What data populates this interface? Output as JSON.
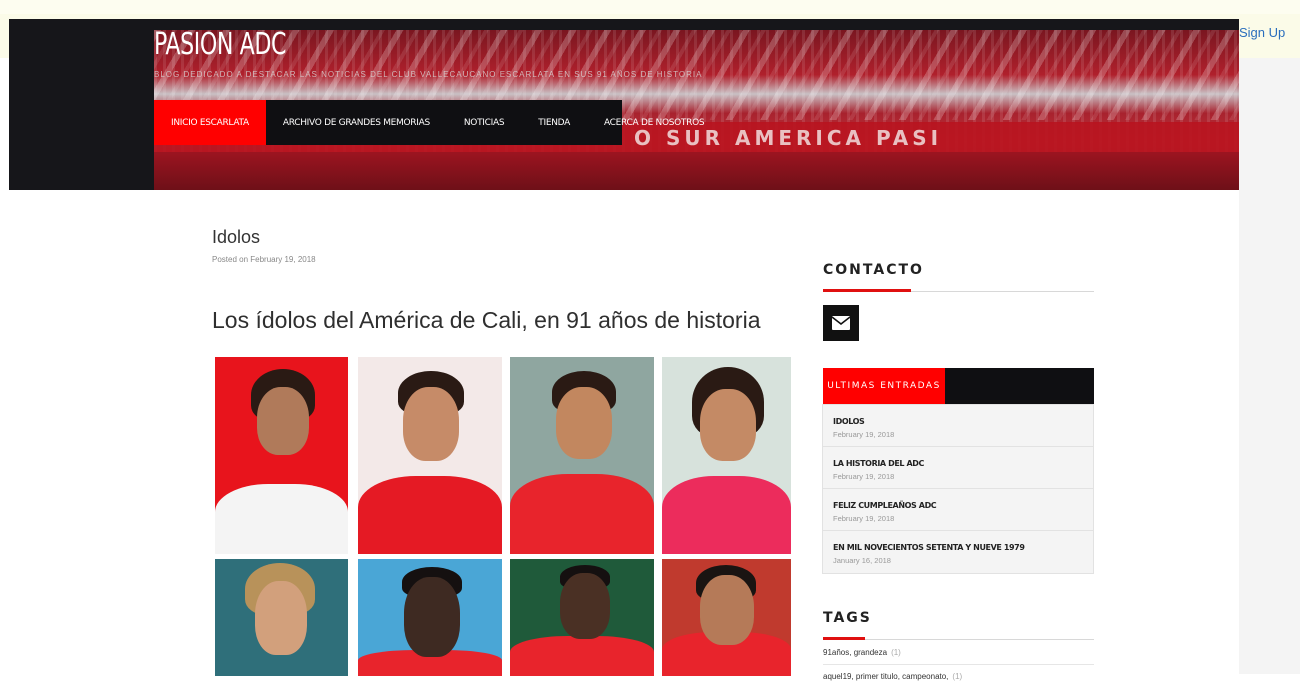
{
  "header": {
    "sign_up": "Sign Up",
    "site_title": "PASION ADC",
    "tagline": "BLOG DEDICADO A DESTACAR LAS NOTICIAS DEL CLUB VALLECAUCANO ESCARLATA EN SUS 91 AÑOS DE HISTORIA",
    "banner_slogan": "O SUR AMERICA PASI",
    "nav": [
      {
        "label": "INICIO ESCARLATA",
        "active": true
      },
      {
        "label": "ARCHIVO DE GRANDES MEMORIAS",
        "active": false
      },
      {
        "label": "NOTICIAS",
        "active": false
      },
      {
        "label": "TIENDA",
        "active": false
      },
      {
        "label": "ACERCA DE NOSOTROS",
        "active": false
      }
    ]
  },
  "post": {
    "title": "Idolos",
    "meta": "Posted on February 19, 2018",
    "heading": "Los ídolos del América de Cali, en 91 años de historia"
  },
  "sidebar": {
    "contact_title": "CONTACTO",
    "mail_icon": "envelope-icon",
    "recent_tab": "ULTIMAS ENTRADAS",
    "recent": [
      {
        "title": "IDOLOS",
        "date": "February 19, 2018"
      },
      {
        "title": "LA HISTORIA DEL ADC",
        "date": "February 19, 2018"
      },
      {
        "title": "FELIZ CUMPLEAÑOS ADC",
        "date": "February 19, 2018"
      },
      {
        "title": "EN MIL NOVECIENTOS SETENTA Y NUEVE 1979",
        "date": "January 16, 2018"
      }
    ],
    "tags_title": "TAGS",
    "tags": [
      {
        "label": "91años, grandeza",
        "count": "(1)"
      },
      {
        "label": "aquel19, primer titulo, campeonato,",
        "count": "(1)"
      }
    ]
  },
  "colors": {
    "accent": "#ff0000",
    "nav_bg": "#0f0f12",
    "header_bg": "#16161a",
    "link": "#2a6ebd"
  }
}
